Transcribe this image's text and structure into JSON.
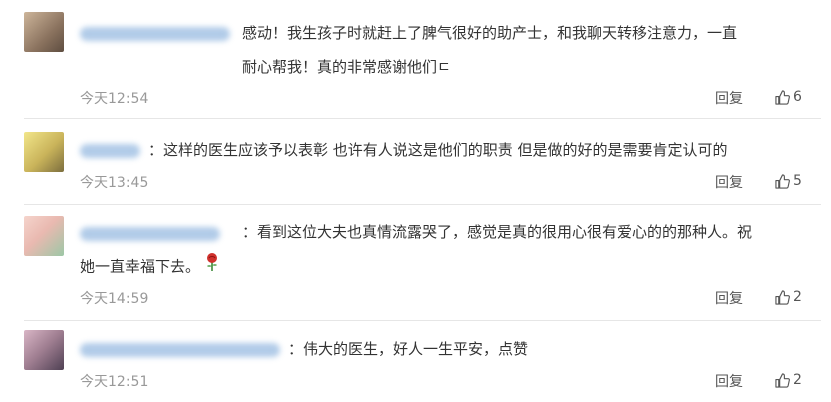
{
  "comments": [
    {
      "text_line1": "感动！我生孩子时就赶上了脾气很好的助产士，和我聊天转移注意力，一直",
      "text_line2": "耐心帮我！真的非常感谢他们ㄷ",
      "time": "今天12:54",
      "reply_label": "回复",
      "likes": "6",
      "avatar_colors": [
        "#bfa58a",
        "#6e5a4a"
      ]
    },
    {
      "text_line1": "：这样的医生应该予以表彰 也许有人说这是他们的职责 但是做的好的是需要肯定认可的",
      "time": "今天13:45",
      "reply_label": "回复",
      "likes": "5",
      "avatar_colors": [
        "#e8dc7a",
        "#b9a34d"
      ]
    },
    {
      "text_line1": "：看到这位大夫也真情流露哭了，感觉是真的很用心很有爱心的的那种人。祝",
      "text_line2": "她一直幸福下去。",
      "time": "今天14:59",
      "reply_label": "回复",
      "likes": "2",
      "avatar_colors": [
        "#f0c9c0",
        "#8fbf9a"
      ]
    },
    {
      "text_line1": "：伟大的医生，好人一生平安，点赞",
      "time": "今天12:51",
      "reply_label": "回复",
      "likes": "2",
      "avatar_colors": [
        "#c5a3b6",
        "#5c4c62"
      ]
    }
  ],
  "icons": {
    "like": "thumbs-up-icon",
    "rose": "rose-emoji-icon"
  },
  "colors": {
    "text": "#333333",
    "meta": "#999999",
    "name_blur": "#a9c6e6",
    "divider": "#e6e6e6"
  }
}
